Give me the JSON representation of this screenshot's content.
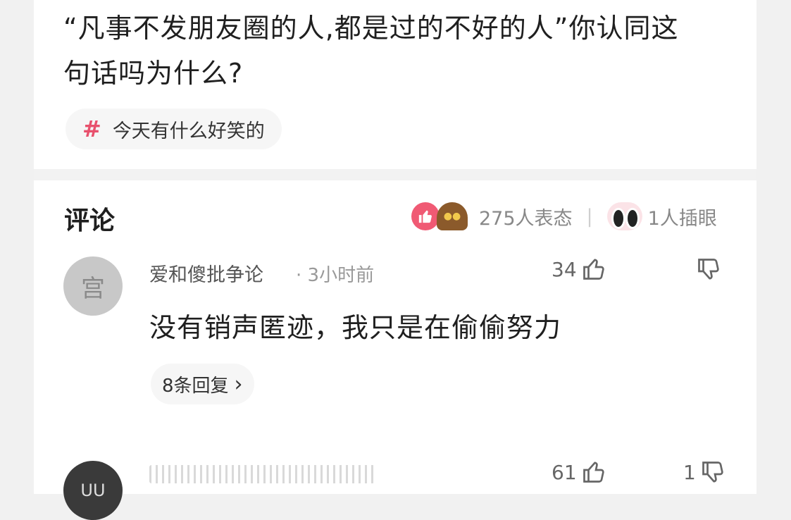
{
  "post": {
    "question_line1": "“凡事不发朋友圈的人,都是过的不好的人”你认同这",
    "question_line2": "句话吗为什么?",
    "topic": {
      "icon": "hash-icon",
      "label": "今天有什么好笑的"
    }
  },
  "comments_section": {
    "title": "评论",
    "reaction_count": "275人表态",
    "insert_eye": "1人插眼",
    "separator": "|"
  },
  "comments": [
    {
      "avatar_char": "宫",
      "username": "爱和傻批争论",
      "time": "· 3小时前",
      "likes": "34",
      "text": "没有销声匿迹，我只是在偷偷努力",
      "replies": "8条回复",
      "reply_chevron": "›"
    },
    {
      "avatar_char": "UU",
      "likes": "61",
      "dislikes": "1"
    }
  ],
  "colors": {
    "accent_pink": "#e8516d",
    "text": "#1f1f1f",
    "muted": "#999999"
  }
}
